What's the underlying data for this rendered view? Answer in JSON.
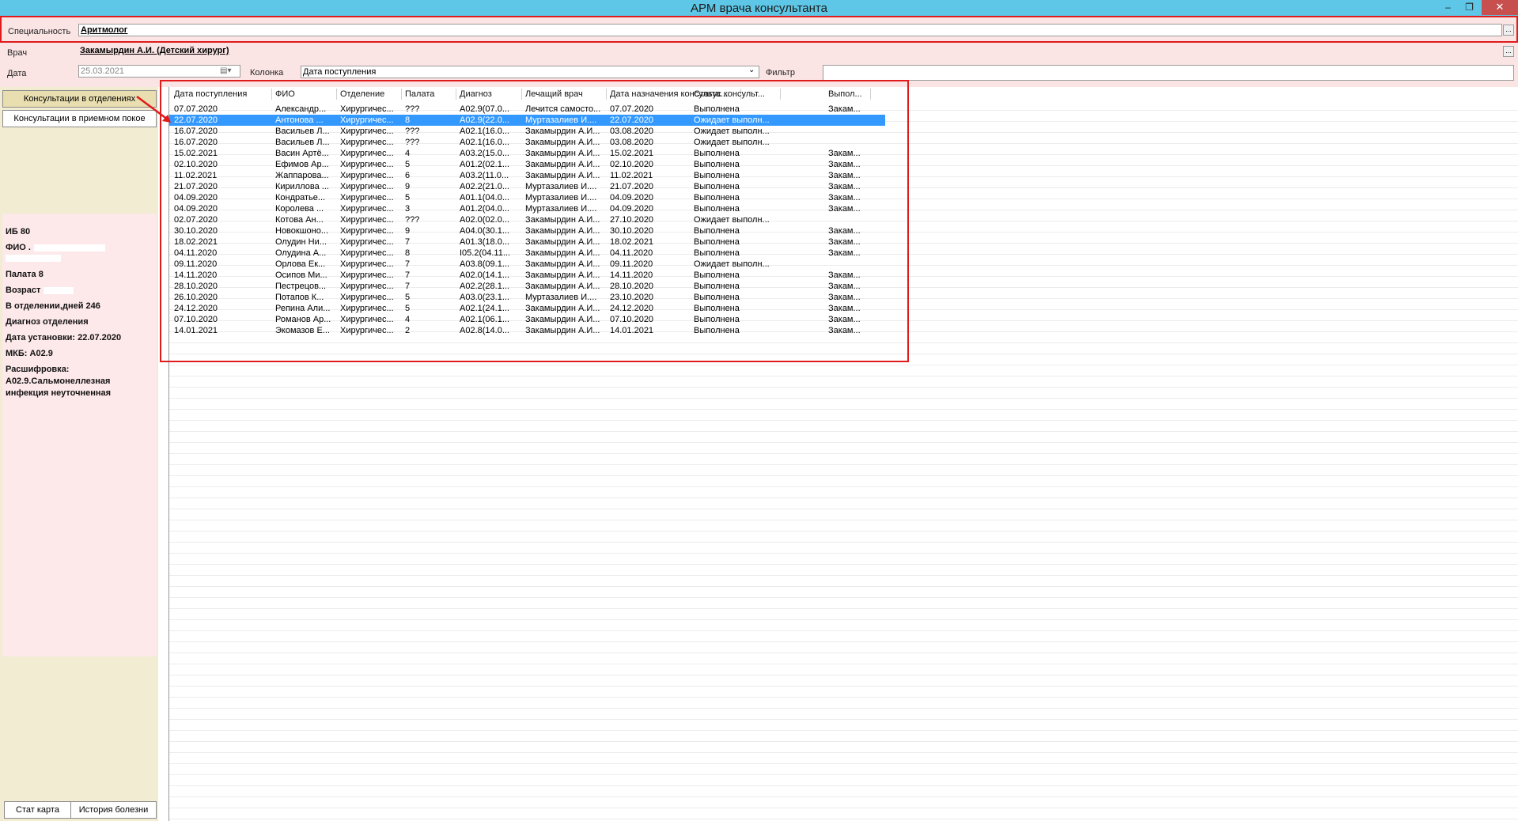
{
  "window": {
    "title": "АРМ врача консультанта",
    "min_symbol": "–",
    "max_symbol": "❐",
    "close_symbol": "✕"
  },
  "filters": {
    "specialty_label": "Специальность",
    "specialty_value": "Аритмолог",
    "doctor_label": "Врач",
    "doctor_value": "Закамырдин А.И. (Детский хирург)",
    "date_label": "Дата",
    "date_value": "25.03.2021",
    "column_label": "Колонка",
    "column_value": "Дата поступления",
    "filter_label": "Фильтр",
    "filter_value": "",
    "ellipsis": "..."
  },
  "left": {
    "btn_departments": "Консультации в отделениях",
    "btn_reception": "Консультации в приемном покое",
    "btn_stat": "Стат карта",
    "btn_history": "История болезни"
  },
  "patient": {
    "ib": "ИБ 80",
    "fio_label": "ФИО .",
    "room": "Палата 8",
    "age_label": "Возраст",
    "days": "В отделении,дней 246",
    "dept_diag": "Диагноз отделения",
    "set_date": "Дата установки: 22.07.2020",
    "mkb": "МКБ: A02.9",
    "decode_label": "Расшифровка:",
    "decode_line1": "A02.9.Сальмонеллезная",
    "decode_line2": "инфекция неуточненная"
  },
  "table": {
    "columns": [
      "Дата поступления",
      "ФИО",
      "Отделение",
      "Палата",
      "Диагноз",
      "Лечащий врач",
      "Дата назначения консульта...",
      "Статус консульт...",
      "Выпол..."
    ],
    "rows": [
      [
        "07.07.2020",
        "Александр...",
        "Хирургичес...",
        "???",
        "A02.9(07.0...",
        "Лечится самосто...",
        "07.07.2020",
        "Выполнена",
        "Закам..."
      ],
      [
        "22.07.2020",
        "Антонова ...",
        "Хирургичес...",
        "8",
        "A02.9(22.0...",
        "Муртазалиев И....",
        "22.07.2020",
        "Ожидает выполн...",
        ""
      ],
      [
        "16.07.2020",
        "Васильев Л...",
        "Хирургичес...",
        "???",
        "A02.1(16.0...",
        "Закамырдин А.И...",
        "03.08.2020",
        "Ожидает выполн...",
        ""
      ],
      [
        "16.07.2020",
        "Васильев Л...",
        "Хирургичес...",
        "???",
        "A02.1(16.0...",
        "Закамырдин А.И...",
        "03.08.2020",
        "Ожидает выполн...",
        ""
      ],
      [
        "15.02.2021",
        "Васин Артё...",
        "Хирургичес...",
        "4",
        "A03.2(15.0...",
        "Закамырдин А.И...",
        "15.02.2021",
        "Выполнена",
        "Закам..."
      ],
      [
        "02.10.2020",
        "Ефимов Ар...",
        "Хирургичес...",
        "5",
        "A01.2(02.1...",
        "Закамырдин А.И...",
        "02.10.2020",
        "Выполнена",
        "Закам..."
      ],
      [
        "11.02.2021",
        "Жаппарова...",
        "Хирургичес...",
        "6",
        "A03.2(11.0...",
        "Закамырдин А.И...",
        "11.02.2021",
        "Выполнена",
        "Закам..."
      ],
      [
        "21.07.2020",
        "Кириллова ...",
        "Хирургичес...",
        "9",
        "A02.2(21.0...",
        "Муртазалиев И....",
        "21.07.2020",
        "Выполнена",
        "Закам..."
      ],
      [
        "04.09.2020",
        "Кондратье...",
        "Хирургичес...",
        "5",
        "A01.1(04.0...",
        "Муртазалиев И....",
        "04.09.2020",
        "Выполнена",
        "Закам..."
      ],
      [
        "04.09.2020",
        "Королева ...",
        "Хирургичес...",
        "3",
        "A01.2(04.0...",
        "Муртазалиев И....",
        "04.09.2020",
        "Выполнена",
        "Закам..."
      ],
      [
        "02.07.2020",
        "Котова Ан...",
        "Хирургичес...",
        "???",
        "A02.0(02.0...",
        "Закамырдин А.И...",
        "27.10.2020",
        "Ожидает выполн...",
        ""
      ],
      [
        "30.10.2020",
        "Новокшоно...",
        "Хирургичес...",
        "9",
        "A04.0(30.1...",
        "Закамырдин А.И...",
        "30.10.2020",
        "Выполнена",
        "Закам..."
      ],
      [
        "18.02.2021",
        "Олудин Ни...",
        "Хирургичес...",
        "7",
        "A01.3(18.0...",
        "Закамырдин А.И...",
        "18.02.2021",
        "Выполнена",
        "Закам..."
      ],
      [
        "04.11.2020",
        "Олудина А...",
        "Хирургичес...",
        "8",
        "I05.2(04.11...",
        "Закамырдин А.И...",
        "04.11.2020",
        "Выполнена",
        "Закам..."
      ],
      [
        "09.11.2020",
        "Орлова Ек...",
        "Хирургичес...",
        "7",
        "A03.8(09.1...",
        "Закамырдин А.И...",
        "09.11.2020",
        "Ожидает выполн...",
        ""
      ],
      [
        "14.11.2020",
        "Осипов Ми...",
        "Хирургичес...",
        "7",
        "A02.0(14.1...",
        "Закамырдин А.И...",
        "14.11.2020",
        "Выполнена",
        "Закам..."
      ],
      [
        "28.10.2020",
        "Пестрецов...",
        "Хирургичес...",
        "7",
        "A02.2(28.1...",
        "Закамырдин А.И...",
        "28.10.2020",
        "Выполнена",
        "Закам..."
      ],
      [
        "26.10.2020",
        "Потапов К...",
        "Хирургичес...",
        "5",
        "A03.0(23.1...",
        "Муртазалиев И....",
        "23.10.2020",
        "Выполнена",
        "Закам..."
      ],
      [
        "24.12.2020",
        "Репина Али...",
        "Хирургичес...",
        "5",
        "A02.1(24.1...",
        "Закамырдин А.И...",
        "24.12.2020",
        "Выполнена",
        "Закам..."
      ],
      [
        "07.10.2020",
        "Романов Ар...",
        "Хирургичес...",
        "4",
        "A02.1(06.1...",
        "Закамырдин А.И...",
        "07.10.2020",
        "Выполнена",
        "Закам..."
      ],
      [
        "14.01.2021",
        "Экомазов Е...",
        "Хирургичес...",
        "2",
        "A02.8(14.0...",
        "Закамырдин А.И...",
        "14.01.2021",
        "Выполнена",
        "Закам..."
      ]
    ],
    "selected_row": 1
  },
  "colors": {
    "titlebar": "#5ec6e6",
    "selection": "#3399ff",
    "highlight": "#e01b1b",
    "left_panel": "#f1ecd2",
    "info_panel": "#fde8ea",
    "filter_row": "#fbe4e4"
  }
}
